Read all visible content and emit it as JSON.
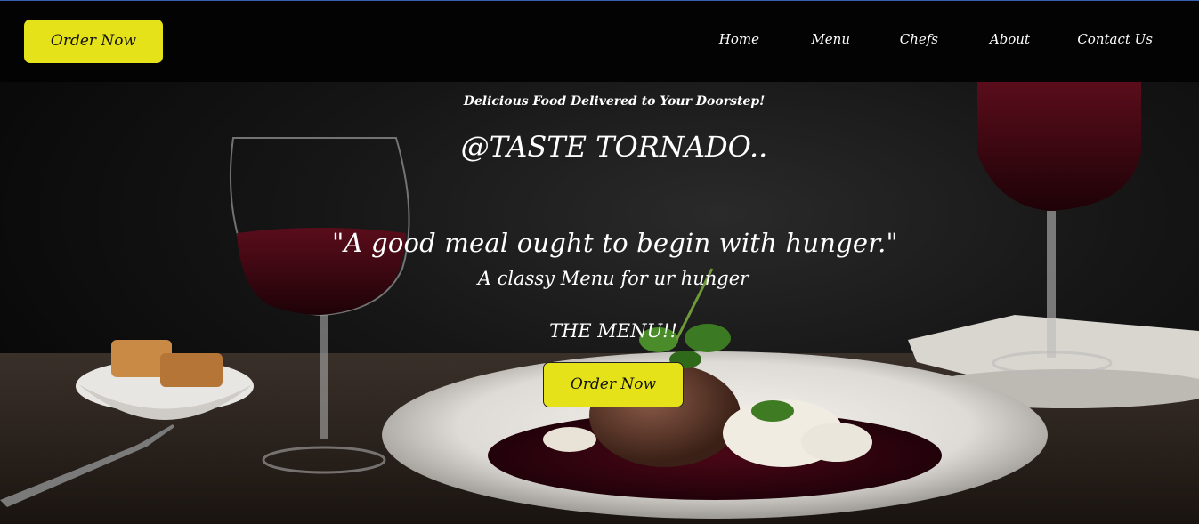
{
  "header": {
    "order_button_label": "Order Now",
    "nav": [
      {
        "label": "Home"
      },
      {
        "label": "Menu"
      },
      {
        "label": "Chefs"
      },
      {
        "label": "About"
      },
      {
        "label": "Contact Us"
      }
    ]
  },
  "hero": {
    "tagline": "Delicious Food Delivered to Your Doorstep!",
    "brand": "@TASTE TORNADO..",
    "quote": "\"A good meal ought to begin with hunger.\"",
    "subtitle": "A classy Menu for ur hunger",
    "menu_heading": "THE MENU!!",
    "order_button_label": "Order Now"
  },
  "colors": {
    "header_bg": "#030303",
    "button_yellow": "#e6e21a",
    "text_white": "#ffffff"
  }
}
